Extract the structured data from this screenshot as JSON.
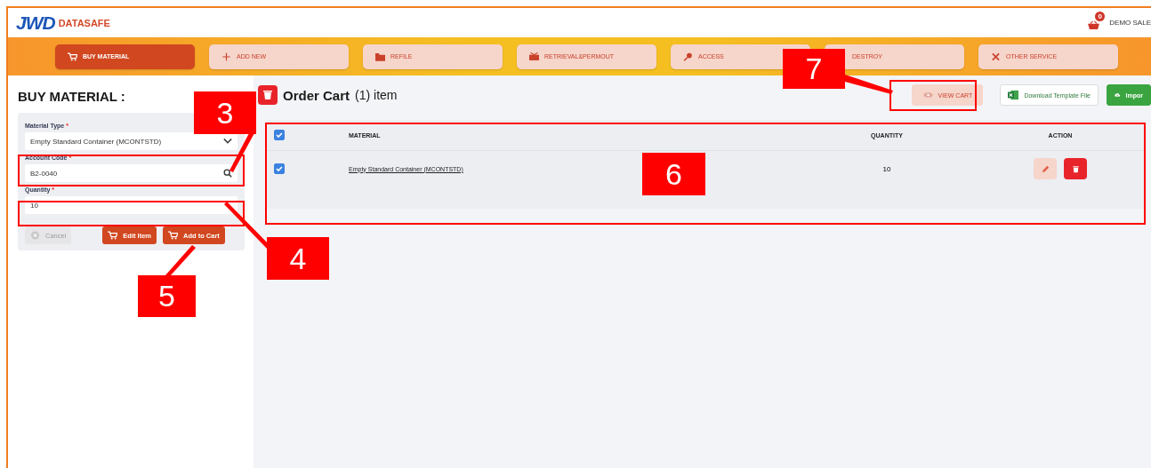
{
  "header": {
    "logo_mark": "JWD",
    "logo_text": "DATASAFE",
    "cart_count": "0",
    "user": "DEMO SALE"
  },
  "nav": [
    {
      "label": "BUY MATERIAL",
      "kind": "cart",
      "selected": true
    },
    {
      "label": "ADD NEW",
      "kind": "plus",
      "selected": false
    },
    {
      "label": "REFILE",
      "kind": "folder",
      "selected": false
    },
    {
      "label": "RETRIEVAL&PERMOUT",
      "kind": "box",
      "selected": false
    },
    {
      "label": "ACCESS",
      "kind": "key",
      "selected": false
    },
    {
      "label": "DESTROY",
      "kind": "covered",
      "selected": false
    },
    {
      "label": "OTHER SERVICE",
      "kind": "tools",
      "selected": false
    }
  ],
  "form": {
    "title": "BUY MATERIAL :",
    "fields": [
      {
        "kind": "select",
        "label": "Material Type",
        "required": "*",
        "value": "Empty Standard Container (MCONTSTD)"
      },
      {
        "kind": "search",
        "label": "Account Code",
        "required": "*",
        "value": "B2-0040"
      },
      {
        "kind": "text",
        "label": "Quantity",
        "required": "*",
        "value": "10"
      }
    ],
    "buttons": [
      {
        "kind": "cancel",
        "label": "Cancel",
        "disabled": true
      },
      {
        "kind": "edit",
        "label": "Edit Item",
        "disabled": false
      },
      {
        "kind": "add",
        "label": "Add to Cart",
        "disabled": false
      }
    ]
  },
  "cart": {
    "title": "Order Cart",
    "count": "(1) item",
    "actions": [
      {
        "kind": "view",
        "label": "VIEW CART"
      },
      {
        "kind": "download",
        "label": "Download Template File"
      },
      {
        "kind": "import",
        "label": "Impor"
      }
    ],
    "columns": [
      "MATERIAL",
      "QUANTITY",
      "ACTION"
    ],
    "all_checked": true,
    "rows": [
      {
        "checked": true,
        "material": "Empty Standard Container (MCONTSTD)",
        "quantity": "10"
      }
    ]
  },
  "annotations": [
    {
      "label": "3"
    },
    {
      "label": "4"
    },
    {
      "label": "5"
    },
    {
      "label": "6"
    },
    {
      "label": "7"
    }
  ]
}
